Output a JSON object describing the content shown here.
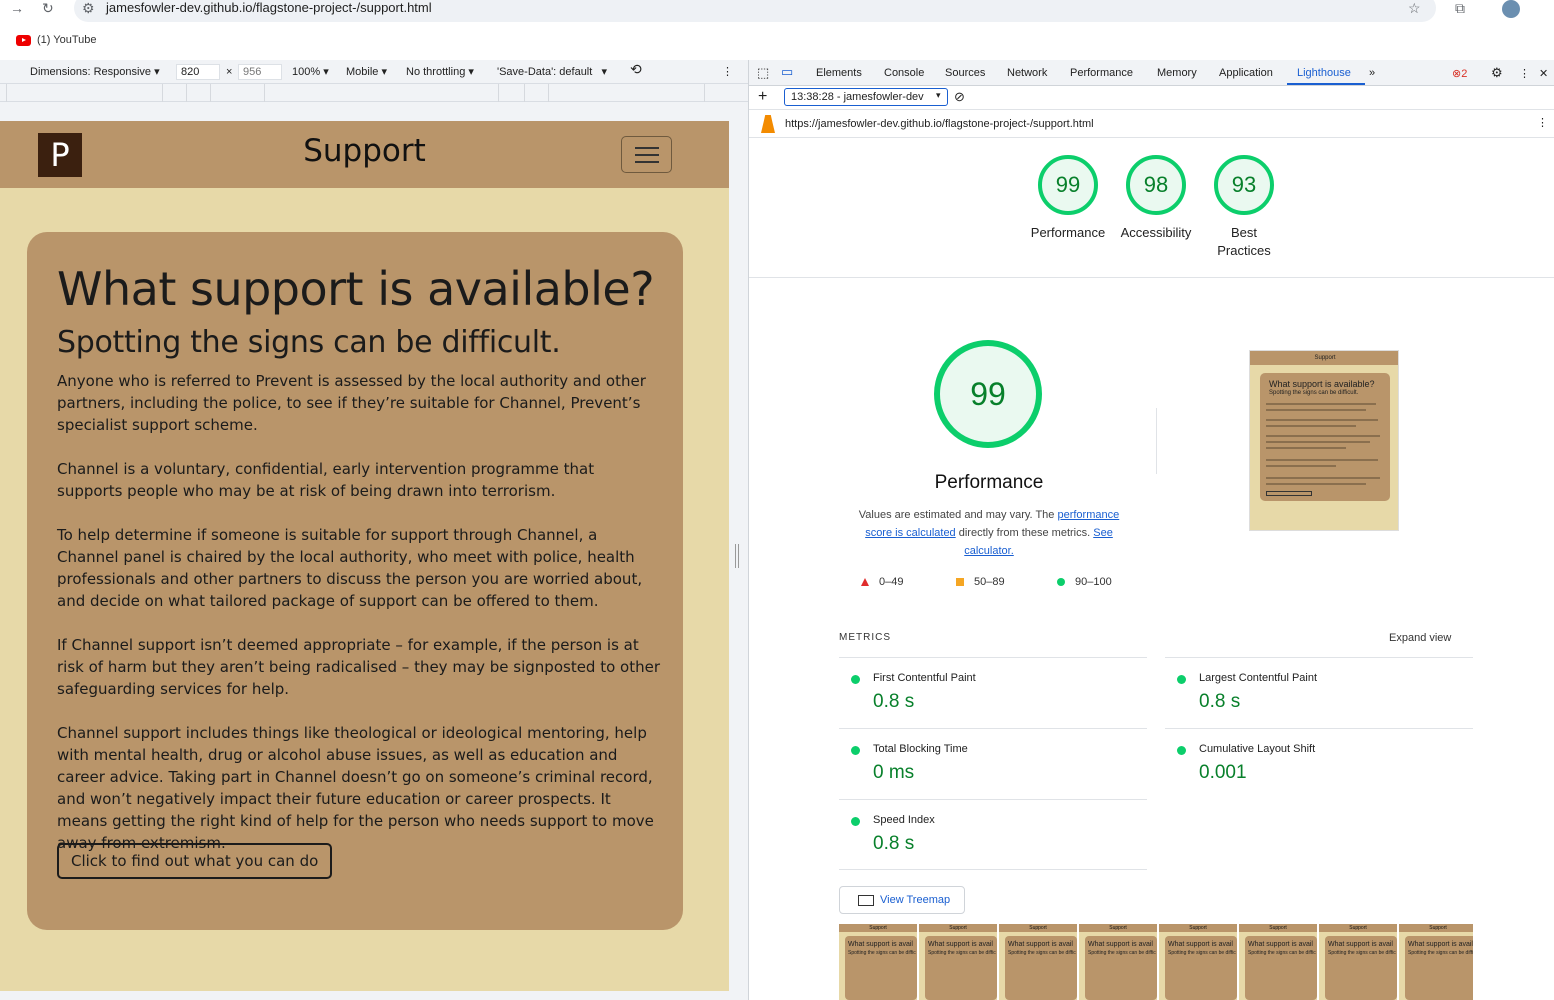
{
  "browser": {
    "url": "jamesfowler-dev.github.io/flagstone-project-/support.html",
    "bookmark": "(1) YouTube"
  },
  "device_toolbar": {
    "dimensions": "Dimensions: Responsive",
    "width": "820",
    "height": "956",
    "zoom": "100%",
    "mode": "Mobile",
    "throttle": "No throttling",
    "savedata": "'Save-Data': default"
  },
  "site": {
    "logo": "P",
    "title": "Support",
    "heading": "What support is available?",
    "subheading": "Spotting the signs can be difficult.",
    "paragraphs": [
      "Anyone who is referred to Prevent is assessed by the local authority and other partners, including the police, to see if they’re suitable for Channel, Prevent’s specialist support scheme.",
      "Channel is a voluntary, confidential, early intervention programme that supports people who may be at risk of being drawn into terrorism.",
      "To help determine if someone is suitable for support through Channel, a Channel panel is chaired by the local authority, who meet with police, health professionals and other partners to discuss the person you are worried about, and decide on what tailored package of support can be offered to them.",
      "If Channel support isn’t deemed appropriate – for example, if the person is at risk of harm but they aren’t being radicalised – they may be signposted to other safeguarding services for help.",
      "Channel support includes things like theological or ideological mentoring, help with mental health, drug or alcohol abuse issues, as well as education and career advice. Taking part in Channel doesn’t go on someone’s criminal record, and won’t negatively impact their future education or career prospects. It means getting the right kind of help for the person who needs support to move away from extremism."
    ],
    "cta": "Click to find out what you can do"
  },
  "devtools": {
    "tabs": [
      "Elements",
      "Console",
      "Sources",
      "Network",
      "Performance",
      "Memory",
      "Application",
      "Lighthouse"
    ],
    "active_tab": "Lighthouse",
    "error_count": "2",
    "report": "13:38:28 - jamesfowler-dev",
    "url": "https://jamesfowler-dev.github.io/flagstone-project-/support.html"
  },
  "lighthouse": {
    "scores": [
      {
        "value": "99",
        "label": "Performance"
      },
      {
        "value": "98",
        "label": "Accessibility"
      },
      {
        "value": "93",
        "label": "Best Practices"
      }
    ],
    "perf_score": "99",
    "perf_title": "Performance",
    "desc_before": "Values are estimated and may vary. The ",
    "desc_link1": "performance score is calculated",
    "desc_mid": " directly from these metrics. ",
    "desc_link2": "See calculator.",
    "legend": [
      "0–49",
      "50–89",
      "90–100"
    ],
    "thumb_title": "Support",
    "thumb_heading": "What support is available?",
    "thumb_sub": "Spotting the signs can be difficult.",
    "metrics_label": "METRICS",
    "expand": "Expand view",
    "metrics": [
      {
        "name": "First Contentful Paint",
        "value": "0.8 s"
      },
      {
        "name": "Largest Contentful Paint",
        "value": "0.8 s"
      },
      {
        "name": "Total Blocking Time",
        "value": "0 ms"
      },
      {
        "name": "Cumulative Layout Shift",
        "value": "0.001"
      },
      {
        "name": "Speed Index",
        "value": "0.8 s"
      }
    ],
    "treemap": "View Treemap",
    "frame_nav": "Support",
    "frame_heading": "What support is avail",
    "frame_sub": "Spotting the signs can be diffic"
  },
  "colors": {
    "site_bg": "#e7d9a8",
    "card": "#b9956a",
    "logo": "#3b200f",
    "pass": "#0cce6b",
    "accent": "#1a5fd1"
  }
}
